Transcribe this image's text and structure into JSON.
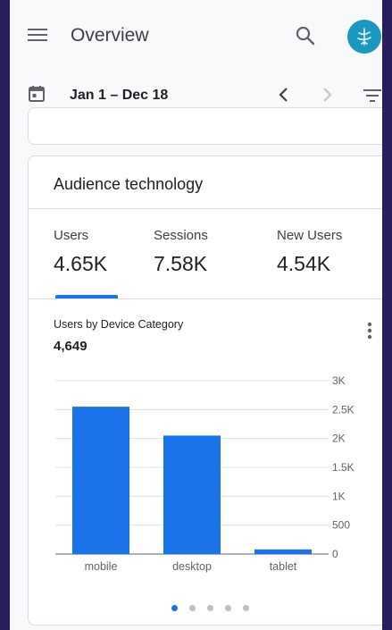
{
  "header": {
    "title": "Overview"
  },
  "datebar": {
    "range": "Jan 1 – Dec 18"
  },
  "card": {
    "title": "Audience technology",
    "metrics": [
      {
        "label": "Users",
        "value": "4.65K"
      },
      {
        "label": "Sessions",
        "value": "7.58K"
      },
      {
        "label": "New Users",
        "value": "4.54K"
      }
    ],
    "selected_metric": "Users"
  },
  "chart": {
    "title": "Users by Device Category",
    "total": "4,649"
  },
  "chart_data": {
    "type": "bar",
    "categories": [
      "mobile",
      "desktop",
      "tablet"
    ],
    "values": [
      2550,
      2050,
      80
    ],
    "ylim": [
      0,
      3000
    ],
    "yticks": [
      0,
      500,
      1000,
      1500,
      2000,
      2500,
      3000
    ],
    "ytick_labels": [
      "0",
      "500",
      "1K",
      "1.5K",
      "2K",
      "2.5K",
      "3K"
    ],
    "grid": true
  },
  "pagination": {
    "count": 5,
    "active": 0
  },
  "colors": {
    "accent": "#1a73e8",
    "bar": "#1a73e8",
    "avatar": "#1a98c2",
    "frame": "#2a1f5c"
  },
  "icons": {
    "menu": "menu-icon",
    "search": "search-icon",
    "calendar": "calendar-icon",
    "prev": "chevron-left-icon",
    "next": "chevron-right-icon",
    "filter": "filter-icon",
    "more": "more-vert-icon"
  }
}
